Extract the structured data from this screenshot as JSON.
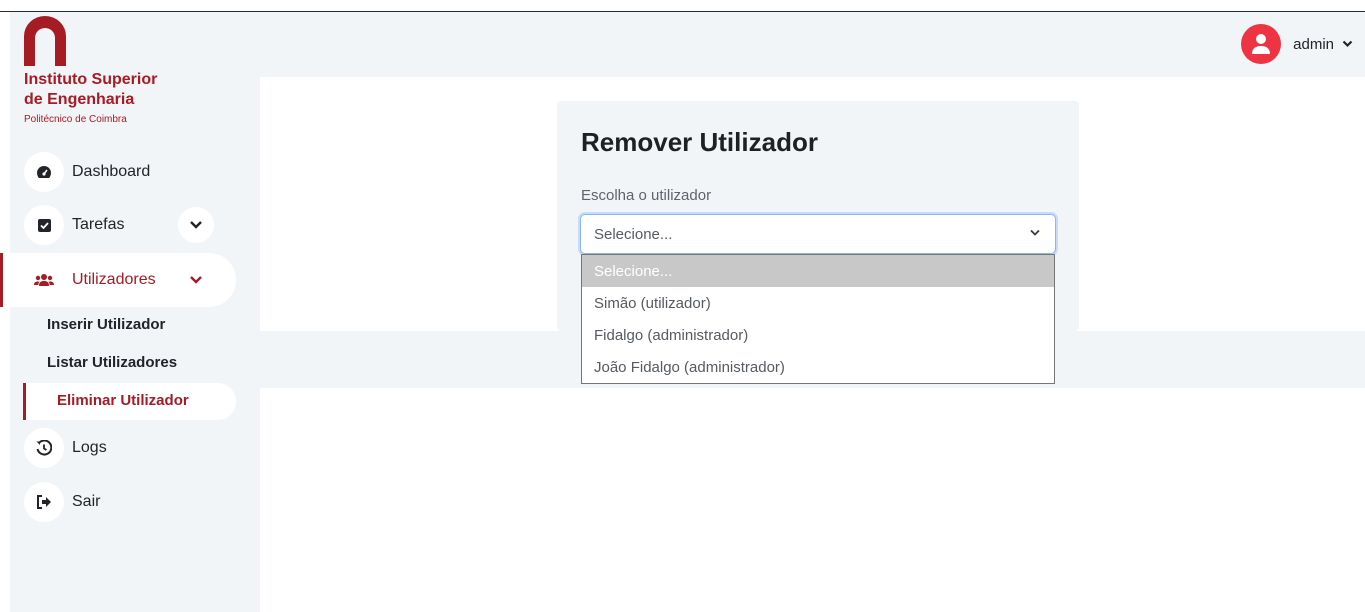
{
  "brand": {
    "line1": "Instituto Superior",
    "line2": "de Engenharia",
    "sub": "Politécnico de Coimbra",
    "color": "#a51c24"
  },
  "user": {
    "name": "admin",
    "avatar_icon": "user-circle-icon"
  },
  "sidebar": {
    "items": [
      {
        "label": "Dashboard",
        "icon": "tachometer-icon"
      },
      {
        "label": "Tarefas",
        "icon": "checkbox-icon"
      },
      {
        "label": "Utilizadores",
        "icon": "users-icon"
      },
      {
        "label": "Logs",
        "icon": "history-icon"
      },
      {
        "label": "Sair",
        "icon": "sign-out-icon"
      }
    ],
    "subitems": [
      {
        "label": "Inserir Utilizador"
      },
      {
        "label": "Listar Utilizadores"
      },
      {
        "label": "Eliminar Utilizador"
      }
    ]
  },
  "form": {
    "title": "Remover Utilizador",
    "label": "Escolha o utilizador",
    "selected": "Selecione...",
    "options": [
      "Selecione...",
      "Simão (utilizador)",
      "Fidalgo (administrador)",
      "João Fidalgo (administrador)"
    ]
  }
}
